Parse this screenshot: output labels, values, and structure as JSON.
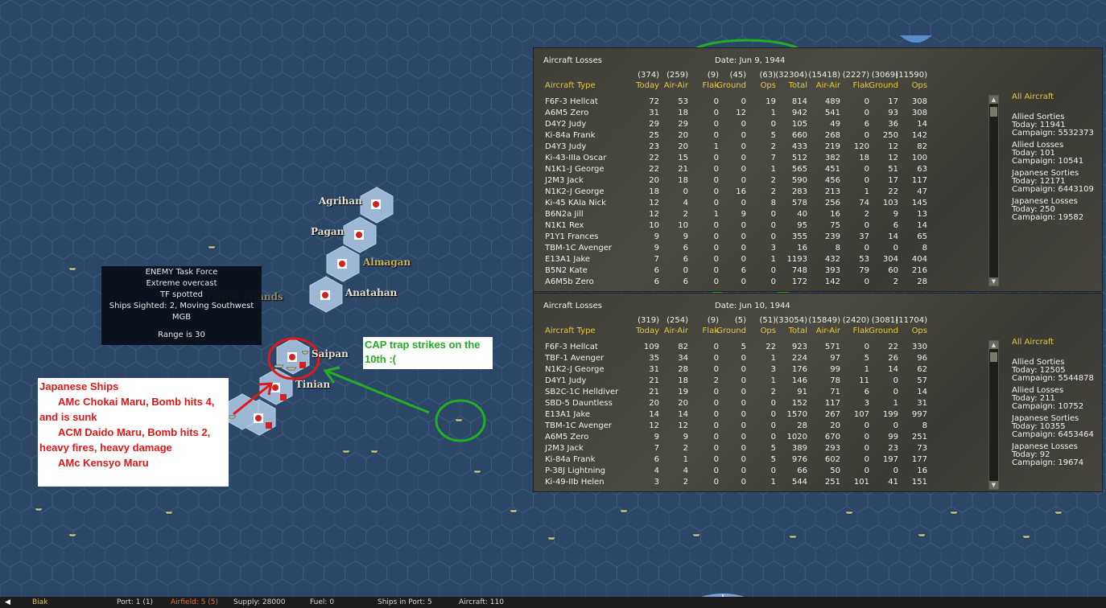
{
  "map": {
    "places": [
      {
        "name": "Agrihan",
        "style": "white"
      },
      {
        "name": "Pagan",
        "style": "white"
      },
      {
        "name": "Almagan",
        "style": "yellow"
      },
      {
        "name": "Anatahan",
        "style": "white"
      },
      {
        "name": "Saipan",
        "style": "white"
      },
      {
        "name": "Tinian",
        "style": "white"
      },
      {
        "name": "Marianas Islands",
        "style": "dim"
      }
    ]
  },
  "tooltip": {
    "lines": [
      "ENEMY Task Force",
      "Extreme overcast",
      "TF spotted",
      "Ships Sighted: 2, Moving Southwest",
      "MGB"
    ],
    "range": "Range is 30"
  },
  "ships_note": {
    "title": "Japanese Ships",
    "entries": [
      "AMc Chokai Maru, Bomb hits 4, and is sunk",
      "ACM Daido Maru, Bomb hits 2, heavy fires,  heavy damage",
      "AMc Kensyo Maru"
    ]
  },
  "cap_note": "CAP trap strikes on the 10th :(",
  "panels": [
    {
      "title": "Aircraft Losses",
      "date": "Date: Jun 9, 1944",
      "totals": [
        "(374)",
        "(259)",
        "(9)",
        "(45)",
        "(63)",
        "(32304)",
        "(15418)",
        "(2227)",
        "(3069)",
        "(11590)"
      ],
      "headers": [
        "Aircraft Type",
        "Today",
        "Air-Air",
        "Flak",
        "Ground",
        "Ops",
        "Total",
        "Air-Air",
        "Flak",
        "Ground",
        "Ops"
      ],
      "rows": [
        [
          "F6F-3 Hellcat",
          "72",
          "53",
          "0",
          "0",
          "19",
          "814",
          "489",
          "0",
          "17",
          "308"
        ],
        [
          "A6M5 Zero",
          "31",
          "18",
          "0",
          "12",
          "1",
          "942",
          "541",
          "0",
          "93",
          "308"
        ],
        [
          "D4Y2 Judy",
          "29",
          "29",
          "0",
          "0",
          "0",
          "105",
          "49",
          "6",
          "36",
          "14"
        ],
        [
          "Ki-84a Frank",
          "25",
          "20",
          "0",
          "0",
          "5",
          "660",
          "268",
          "0",
          "250",
          "142"
        ],
        [
          "D4Y3 Judy",
          "23",
          "20",
          "1",
          "0",
          "2",
          "433",
          "219",
          "120",
          "12",
          "82"
        ],
        [
          "Ki-43-IIIa Oscar",
          "22",
          "15",
          "0",
          "0",
          "7",
          "512",
          "382",
          "18",
          "12",
          "100"
        ],
        [
          "N1K1-J George",
          "22",
          "21",
          "0",
          "0",
          "1",
          "565",
          "451",
          "0",
          "51",
          "63"
        ],
        [
          "J2M3 Jack",
          "20",
          "18",
          "0",
          "0",
          "2",
          "590",
          "456",
          "0",
          "17",
          "117"
        ],
        [
          "N1K2-J George",
          "18",
          "0",
          "0",
          "16",
          "2",
          "283",
          "213",
          "1",
          "22",
          "47"
        ],
        [
          "Ki-45 KAIa Nick",
          "12",
          "4",
          "0",
          "0",
          "8",
          "578",
          "256",
          "74",
          "103",
          "145"
        ],
        [
          "B6N2a Jill",
          "12",
          "2",
          "1",
          "9",
          "0",
          "40",
          "16",
          "2",
          "9",
          "13"
        ],
        [
          "N1K1 Rex",
          "10",
          "10",
          "0",
          "0",
          "0",
          "95",
          "75",
          "0",
          "6",
          "14"
        ],
        [
          "P1Y1 Frances",
          "9",
          "9",
          "0",
          "0",
          "0",
          "355",
          "239",
          "37",
          "14",
          "65"
        ],
        [
          "TBM-1C Avenger",
          "9",
          "6",
          "0",
          "0",
          "3",
          "16",
          "8",
          "0",
          "0",
          "8"
        ],
        [
          "E13A1 Jake",
          "7",
          "6",
          "0",
          "0",
          "1",
          "1193",
          "432",
          "53",
          "304",
          "404"
        ],
        [
          "B5N2 Kate",
          "6",
          "0",
          "0",
          "6",
          "0",
          "748",
          "393",
          "79",
          "60",
          "216"
        ],
        [
          "A6M5b Zero",
          "6",
          "6",
          "0",
          "0",
          "0",
          "172",
          "142",
          "0",
          "2",
          "28"
        ]
      ],
      "side": {
        "all": "All Aircraft",
        "blocks": [
          {
            "title": "Allied Sorties",
            "today": "Today:  11941",
            "campaign": "Campaign: 5532373"
          },
          {
            "title": "Allied Losses",
            "today": "Today:  101",
            "campaign": "Campaign: 10541"
          },
          {
            "title": "Japanese Sorties",
            "today": "Today:  12171",
            "campaign": "Campaign: 6443109"
          },
          {
            "title": "Japanese Losses",
            "today": "Today:  250",
            "campaign": "Campaign: 19582"
          }
        ]
      }
    },
    {
      "title": "Aircraft Losses",
      "date": "Date: Jun 10, 1944",
      "totals": [
        "(319)",
        "(254)",
        "(9)",
        "(5)",
        "(51)",
        "(33054)",
        "(15849)",
        "(2420)",
        "(3081)",
        "(11704)"
      ],
      "headers": [
        "Aircraft Type",
        "Today",
        "Air-Air",
        "Flak",
        "Ground",
        "Ops",
        "Total",
        "Air-Air",
        "Flak",
        "Ground",
        "Ops"
      ],
      "rows": [
        [
          "F6F-3 Hellcat",
          "109",
          "82",
          "0",
          "5",
          "22",
          "923",
          "571",
          "0",
          "22",
          "330"
        ],
        [
          "TBF-1 Avenger",
          "35",
          "34",
          "0",
          "0",
          "1",
          "224",
          "97",
          "5",
          "26",
          "96"
        ],
        [
          "N1K2-J George",
          "31",
          "28",
          "0",
          "0",
          "3",
          "176",
          "99",
          "1",
          "14",
          "62"
        ],
        [
          "D4Y1 Judy",
          "21",
          "18",
          "2",
          "0",
          "1",
          "146",
          "78",
          "11",
          "0",
          "57"
        ],
        [
          "SB2C-1C Helldiver",
          "21",
          "19",
          "0",
          "0",
          "2",
          "91",
          "71",
          "6",
          "0",
          "14"
        ],
        [
          "SBD-5 Dauntless",
          "20",
          "20",
          "0",
          "0",
          "0",
          "152",
          "117",
          "3",
          "1",
          "31"
        ],
        [
          "E13A1 Jake",
          "14",
          "14",
          "0",
          "0",
          "0",
          "1570",
          "267",
          "107",
          "199",
          "997"
        ],
        [
          "TBM-1C Avenger",
          "12",
          "12",
          "0",
          "0",
          "0",
          "28",
          "20",
          "0",
          "0",
          "8"
        ],
        [
          "A6M5 Zero",
          "9",
          "9",
          "0",
          "0",
          "0",
          "1020",
          "670",
          "0",
          "99",
          "251"
        ],
        [
          "J2M3 Jack",
          "7",
          "2",
          "0",
          "0",
          "5",
          "389",
          "293",
          "0",
          "23",
          "73"
        ],
        [
          "Ki-84a Frank",
          "6",
          "1",
          "0",
          "0",
          "5",
          "976",
          "602",
          "0",
          "197",
          "177"
        ],
        [
          "P-38J Lightning",
          "4",
          "4",
          "0",
          "0",
          "0",
          "66",
          "50",
          "0",
          "0",
          "16"
        ],
        [
          "Ki-49-IIb Helen",
          "3",
          "2",
          "0",
          "0",
          "1",
          "544",
          "251",
          "101",
          "41",
          "151"
        ]
      ],
      "side": {
        "all": "All Aircraft",
        "blocks": [
          {
            "title": "Allied Sorties",
            "today": "Today:  12505",
            "campaign": "Campaign: 5544878"
          },
          {
            "title": "Allied Losses",
            "today": "Today:  211",
            "campaign": "Campaign: 10752"
          },
          {
            "title": "Japanese Sorties",
            "today": "Today:  10355",
            "campaign": "Campaign: 6453464"
          },
          {
            "title": "Japanese Losses",
            "today": "Today:  92",
            "campaign": "Campaign: 19674"
          }
        ]
      }
    }
  ],
  "statusbar": {
    "base": "Biak",
    "port": "Port: 1 (1)",
    "airfield": "Airfield: 5 (5)",
    "supply": "Supply: 28000",
    "fuel": "Fuel: 0",
    "ships": "Ships in Port: 5",
    "aircraft": "Aircraft: 110"
  },
  "colors": {
    "sea": "#2c4668",
    "highlight": "#a8c4e0",
    "annotation_red": "#e01818",
    "annotation_green": "#22b022",
    "header_yellow": "#e8c838"
  }
}
